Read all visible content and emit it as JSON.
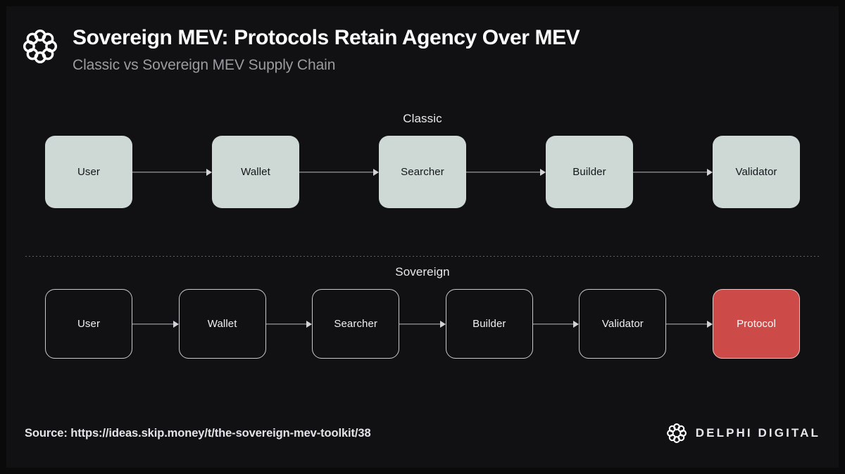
{
  "header": {
    "logo_icon": "delphi-ring-icon",
    "title": "Sovereign MEV: Protocols Retain Agency Over MEV",
    "subtitle": "Classic vs Sovereign MEV Supply Chain"
  },
  "diagram": {
    "colors": {
      "background": "#111113",
      "classic_node": "#ced8d5",
      "classic_text": "#13161a",
      "sovereign_border": "#c9c9cd",
      "sovereign_text": "#f0f0f2",
      "accent": "#cc4a48",
      "connector": "#b9b9bd"
    },
    "rows": [
      {
        "label": "Classic",
        "style": "filled",
        "nodes": [
          {
            "label": "User"
          },
          {
            "label": "Wallet"
          },
          {
            "label": "Searcher"
          },
          {
            "label": "Builder"
          },
          {
            "label": "Validator"
          }
        ]
      },
      {
        "label": "Sovereign",
        "style": "outlined",
        "nodes": [
          {
            "label": "User"
          },
          {
            "label": "Wallet"
          },
          {
            "label": "Searcher"
          },
          {
            "label": "Builder"
          },
          {
            "label": "Validator"
          },
          {
            "label": "Protocol",
            "accent": true
          }
        ]
      }
    ]
  },
  "footer": {
    "source": "Source: https://ideas.skip.money/t/the-sovereign-mev-toolkit/38",
    "brand_icon": "delphi-ring-icon",
    "brand_name": "DELPHI DIGITAL"
  }
}
